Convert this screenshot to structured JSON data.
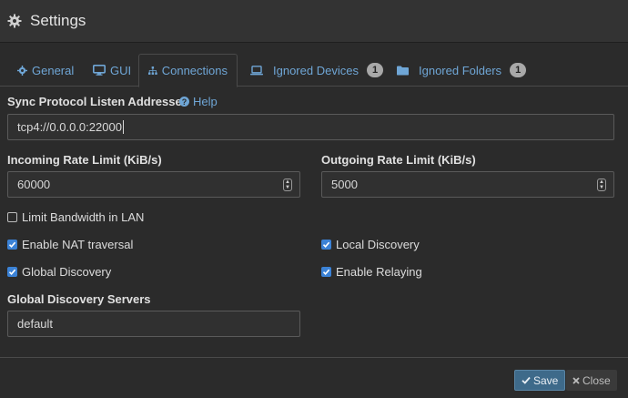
{
  "header": {
    "title": "Settings",
    "icon": "gear-icon"
  },
  "tabs": [
    {
      "label": "General",
      "icon": "cog-icon"
    },
    {
      "label": "GUI",
      "icon": "monitor-icon"
    },
    {
      "label": "Connections",
      "icon": "sitemap-icon",
      "active": true
    },
    {
      "label": "Ignored Devices",
      "icon": "laptop-icon",
      "badge": "1"
    },
    {
      "label": "Ignored Folders",
      "icon": "folder-icon",
      "badge": "1"
    }
  ],
  "sync": {
    "label": "Sync Protocol Listen Addresses",
    "help": "Help",
    "value": "tcp4://0.0.0.0:22000"
  },
  "incoming": {
    "label": "Incoming Rate Limit (KiB/s)",
    "value": "60000"
  },
  "outgoing": {
    "label": "Outgoing Rate Limit (KiB/s)",
    "value": "5000"
  },
  "checks": {
    "limit_lan": {
      "label": "Limit Bandwidth in LAN",
      "checked": false
    },
    "nat": {
      "label": "Enable NAT traversal",
      "checked": true
    },
    "local_discovery": {
      "label": "Local Discovery",
      "checked": true
    },
    "global_discovery": {
      "label": "Global Discovery",
      "checked": true
    },
    "relaying": {
      "label": "Enable Relaying",
      "checked": true
    }
  },
  "discovery_servers": {
    "label": "Global Discovery Servers",
    "value": "default"
  },
  "footer": {
    "save": "Save",
    "close": "Close"
  },
  "colors": {
    "accent": "#6fa6d6",
    "checkbox": "#3b82d6",
    "save_bg": "#3e6a8a"
  }
}
